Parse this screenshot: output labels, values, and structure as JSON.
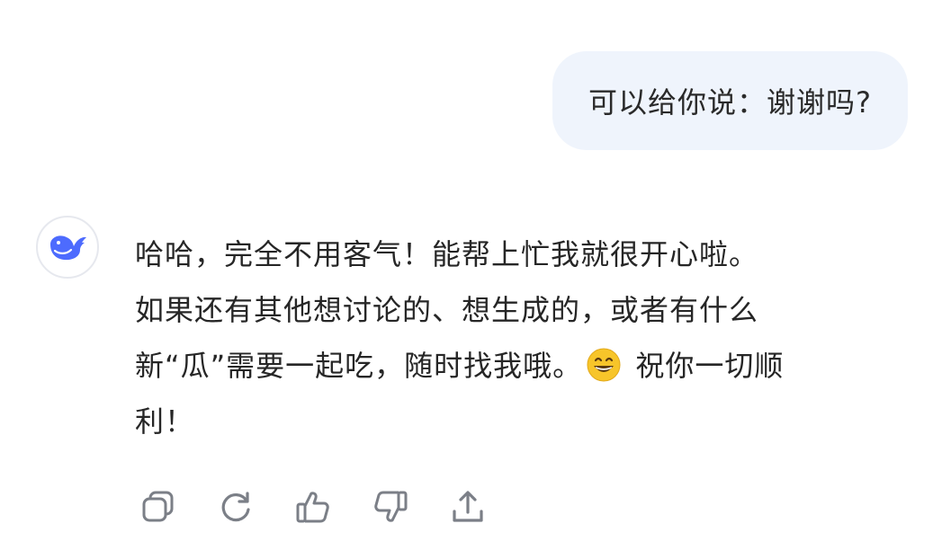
{
  "user_message": {
    "text": "可以给你说：谢谢吗?"
  },
  "assistant": {
    "avatar_icon": "deepseek-whale-icon",
    "reply_lines": [
      "哈哈，完全不用客气！能帮上忙我就很开心啦。",
      "如果还有其他想讨论的、想生成的，或者有什么",
      "新“瓜”需要一起吃，随时找我哦。",
      " 祝你一切顺",
      "利！"
    ],
    "emoji_icon": "grinning-face-emoji-icon"
  },
  "actions": [
    {
      "icon": "copy-icon"
    },
    {
      "icon": "regenerate-icon"
    },
    {
      "icon": "thumbs-up-icon"
    },
    {
      "icon": "thumbs-down-icon"
    },
    {
      "icon": "share-icon"
    }
  ],
  "colors": {
    "user_bubble_bg": "#eff4fc",
    "text": "#262626",
    "icon": "#7b7f87",
    "brand_blue": "#4d6bfe"
  }
}
